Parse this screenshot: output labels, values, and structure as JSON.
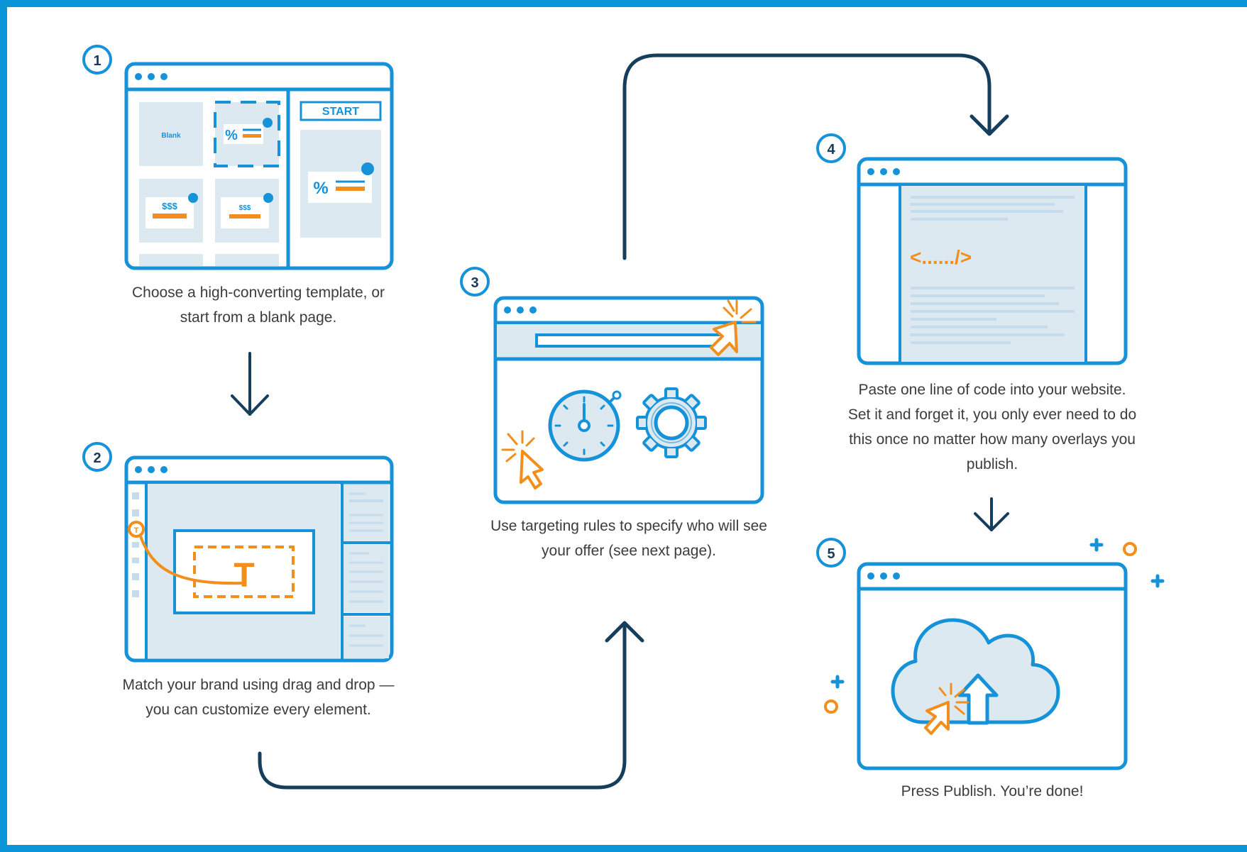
{
  "colors": {
    "blue": "#1692d8",
    "navy": "#153e5c",
    "orange": "#f28f1c",
    "panel": "#dde9f1",
    "text": "#3c3c3c"
  },
  "steps": [
    {
      "number": "1",
      "caption": "Choose a high-converting template, or start from a blank page."
    },
    {
      "number": "2",
      "caption": "Match your brand using drag and drop — you can customize every element."
    },
    {
      "number": "3",
      "caption": "Use targeting rules to specify who will see your offer (see next page)."
    },
    {
      "number": "4",
      "caption": "Paste one line of code into your website. Set it and forget it, you only ever need to do this once no matter how many overlays you publish."
    },
    {
      "number": "5",
      "caption": "Press Publish. You’re done!"
    }
  ],
  "step1_window": {
    "blank_label": "Blank",
    "start_label": "START",
    "percent_symbol": "%",
    "price_label_large": "$$$",
    "price_label_small": "$$$"
  },
  "step2_window": {
    "text_tool_letter": "T",
    "text_placeholder_letter": "T"
  },
  "step4_window": {
    "code_snippet": "<....../>"
  },
  "icons": [
    "dots-icon",
    "cursor-click-icon",
    "stopwatch-icon",
    "gear-icon",
    "cloud-upload-icon",
    "code-icon",
    "plus-icon",
    "circle-icon",
    "arrow-down-icon",
    "arrow-up-icon"
  ]
}
